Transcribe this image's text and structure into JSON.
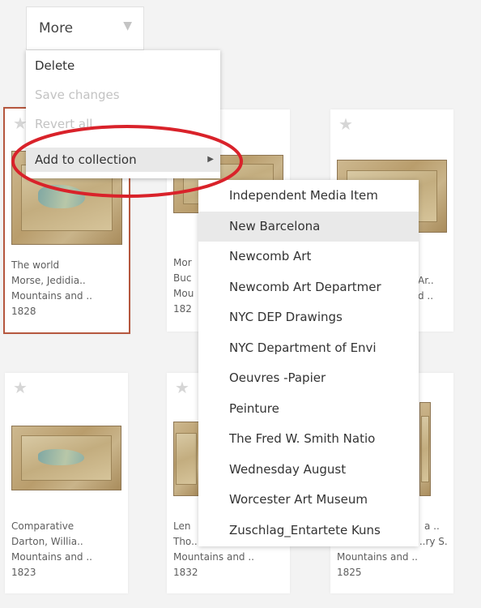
{
  "toolbar": {
    "more_label": "More"
  },
  "menu": {
    "items": [
      {
        "label": "Delete",
        "state": "enabled"
      },
      {
        "label": "Save changes",
        "state": "disabled"
      },
      {
        "label": "Revert all",
        "state": "disabled"
      },
      {
        "label": "Add to collection",
        "state": "active"
      }
    ]
  },
  "submenu": {
    "items": [
      "Independent Media Item",
      "New Barcelona",
      "Newcomb Art",
      "Newcomb Art Departmer",
      "NYC DEP Drawings",
      "NYC Department of Envi",
      "Oeuvres -Papier",
      "Peinture",
      "The Fred W. Smith Natio",
      "Wednesday August",
      "Worcester Art Museum",
      "Zuschlag_Entartete Kuns"
    ],
    "hovered_index": 1
  },
  "cards": [
    {
      "lines": [
        "The world",
        "Morse, Jedidia..",
        "Mountains and ..",
        "1828"
      ],
      "selected": true
    },
    {
      "lines": [
        "Mor",
        "Buc",
        "Mou",
        "182"
      ],
      "selected": false
    },
    {
      "lines": [
        "",
        "Ar..",
        "d ..",
        ""
      ],
      "selected": false
    },
    {
      "lines": [
        "Comparative",
        "Darton, Willia..",
        "Mountains and ..",
        "1823"
      ],
      "selected": false
    },
    {
      "lines": [
        "Len",
        "Tho...",
        "Mountains and ..",
        "1832"
      ],
      "selected": false
    },
    {
      "lines": [
        "a ..",
        "...ry S.",
        "Mountains and ..",
        "1825"
      ],
      "selected": false
    }
  ],
  "colors": {
    "annotation_ring": "#d9222a",
    "selected_border": "#b5573e",
    "menu_active_bg": "#e8e8e8"
  },
  "icons": {
    "star": "star-icon",
    "chevron": "chevron-down-icon",
    "submenu_arrow": "caret-right-icon"
  }
}
